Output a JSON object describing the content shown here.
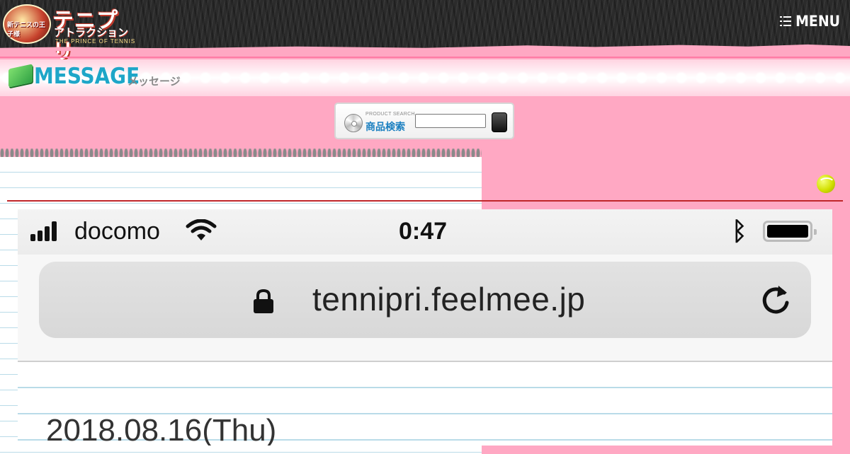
{
  "header": {
    "logo_emblem": "新テニスの王子様",
    "logo_title": "テニプリ",
    "logo_sub": "アトラクション",
    "logo_en": "THE PRINCE OF TENNIS",
    "menu_label": "MENU"
  },
  "message": {
    "title": "MESSAGE",
    "subtitle": "メッセージ"
  },
  "search": {
    "small_label": "PRODUCT SEARCH",
    "label": "商品検索",
    "value": ""
  },
  "phone": {
    "carrier": "docomo",
    "time": "0:47",
    "url": "tennipri.feelmee.jp",
    "date": "2018.08.16(Thu)"
  },
  "colors": {
    "background_pink": "#ffa8c3",
    "header_dark": "#2b2b2b",
    "title_blue": "#1ea6c8",
    "rule_red": "#c0262a"
  },
  "icons": [
    "menu-icon",
    "envelope-icon",
    "cd-icon",
    "search-button",
    "tennis-ball-icon",
    "signal-icon",
    "wifi-icon",
    "bluetooth-icon",
    "battery-icon",
    "lock-icon",
    "reload-icon"
  ]
}
